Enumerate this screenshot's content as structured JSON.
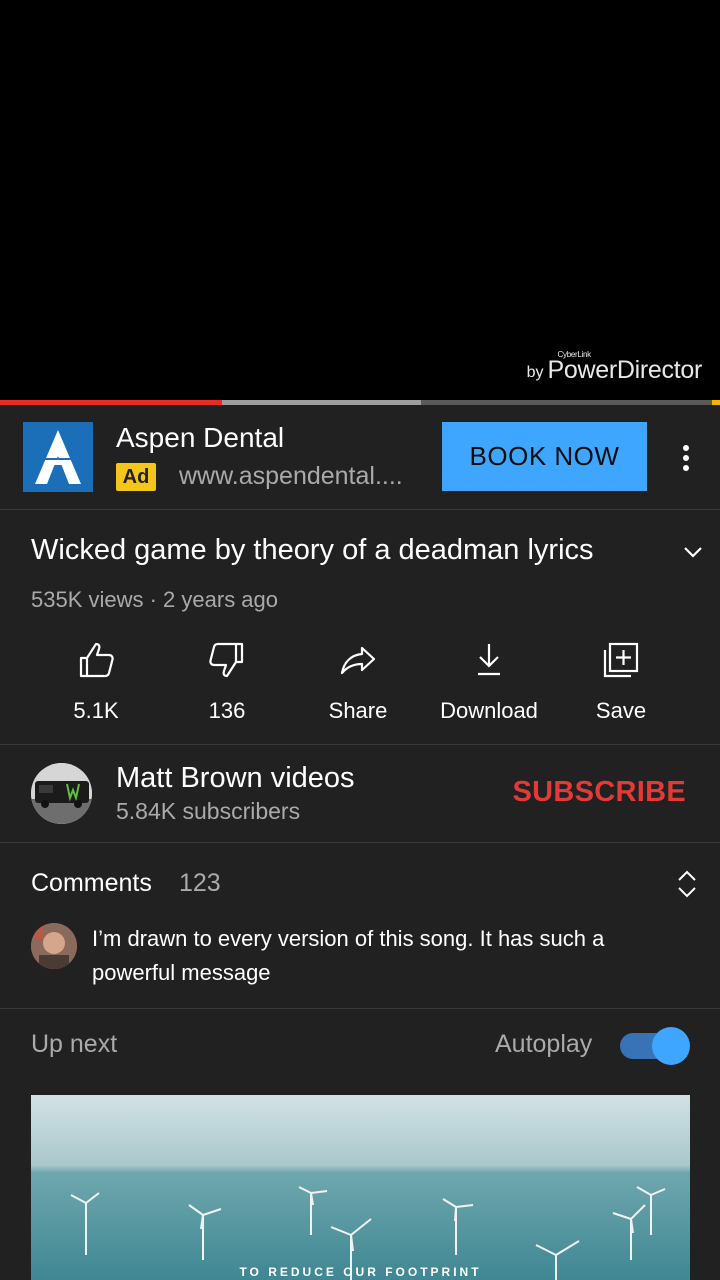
{
  "player": {
    "watermark_by": "by",
    "watermark_small": "CyberLink",
    "watermark_brand": "PowerDirector",
    "progress_played_fraction": 0.308,
    "progress_buffered_fraction": 0.585
  },
  "ad": {
    "title": "Aspen Dental",
    "badge": "Ad",
    "url": "www.aspendental....",
    "cta": "BOOK NOW",
    "logo_color": "#1a6fb8",
    "cta_color": "#3ea6ff",
    "badge_color": "#f4c51a"
  },
  "video": {
    "title": "Wicked game by theory of a deadman lyrics",
    "meta": "535K views · 2 years ago"
  },
  "actions": {
    "like": "5.1K",
    "dislike": "136",
    "share": "Share",
    "download": "Download",
    "save": "Save"
  },
  "channel": {
    "name": "Matt Brown videos",
    "subscribers": "5.84K subscribers",
    "subscribe": "SUBSCRIBE",
    "subscribe_color": "#e53935"
  },
  "comments": {
    "heading": "Comments",
    "count": "123",
    "top_comment": "I’m drawn to every version of this song. It has such a powerful message"
  },
  "upnext": {
    "label": "Up next",
    "autoplay_label": "Autoplay",
    "autoplay_on": true,
    "thumbnail_caption": "TO REDUCE OUR FOOTPRINT"
  },
  "icons": {
    "like": "thumb-up-icon",
    "dislike": "thumb-down-icon",
    "share": "share-arrow-icon",
    "download": "download-icon",
    "save": "playlist-add-icon",
    "more": "more-vert-icon",
    "expand": "chevron-down-icon",
    "comments_toggle": "unfold-icon"
  }
}
